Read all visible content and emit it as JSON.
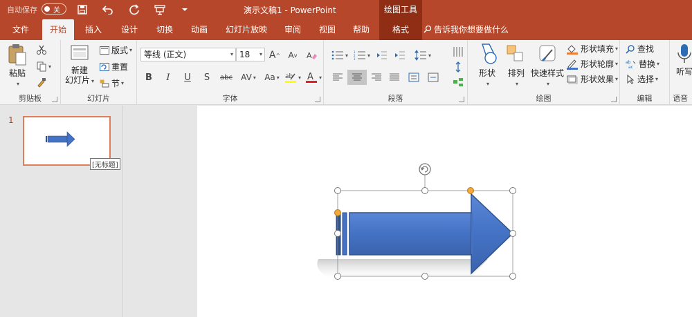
{
  "titlebar": {
    "autosave_label": "自动保存",
    "autosave_state": "关",
    "doc_title": "演示文稿1  -  PowerPoint",
    "context_tools": "绘图工具",
    "icons": [
      "save-icon",
      "undo-icon",
      "redo-icon",
      "present-icon",
      "customize-icon"
    ]
  },
  "tabs": {
    "file": "文件",
    "home": "开始",
    "insert": "插入",
    "design": "设计",
    "transitions": "切换",
    "animations": "动画",
    "slideshow": "幻灯片放映",
    "review": "审阅",
    "view": "视图",
    "help": "帮助",
    "format": "格式",
    "tell_me": "告诉我你想要做什么"
  },
  "ribbon": {
    "clipboard": {
      "label": "剪贴板",
      "paste": "粘贴"
    },
    "slides": {
      "label": "幻灯片",
      "new_slide_1": "新建",
      "new_slide_2": "幻灯片",
      "layout": "版式",
      "reset": "重置",
      "section": "节"
    },
    "font": {
      "label": "字体",
      "font_name": "等线 (正文)",
      "font_size": "18",
      "bold": "B",
      "italic": "I",
      "underline": "U",
      "shadow": "S",
      "strike": "abc",
      "spacing": "AV",
      "case": "Aa",
      "grow": "A",
      "shrink": "A"
    },
    "paragraph": {
      "label": "段落"
    },
    "drawing": {
      "label": "绘图",
      "shapes": "形状",
      "arrange": "排列",
      "quick_styles": "快速样式",
      "fill": "形状填充",
      "outline": "形状轮廓",
      "effects": "形状效果"
    },
    "editing": {
      "label": "编辑",
      "find": "查找",
      "replace": "替换",
      "select": "选择"
    },
    "voice": {
      "label": "语音",
      "dictate": "听写"
    }
  },
  "thumbnails": {
    "slide_number": "1",
    "tooltip": "[无标题]"
  },
  "colors": {
    "brand": "#b7472a",
    "context": "#8f2d15",
    "shape_fill": "#4472c4",
    "shape_outline": "#2f528f",
    "handle_yellow": "#f4a93b"
  }
}
